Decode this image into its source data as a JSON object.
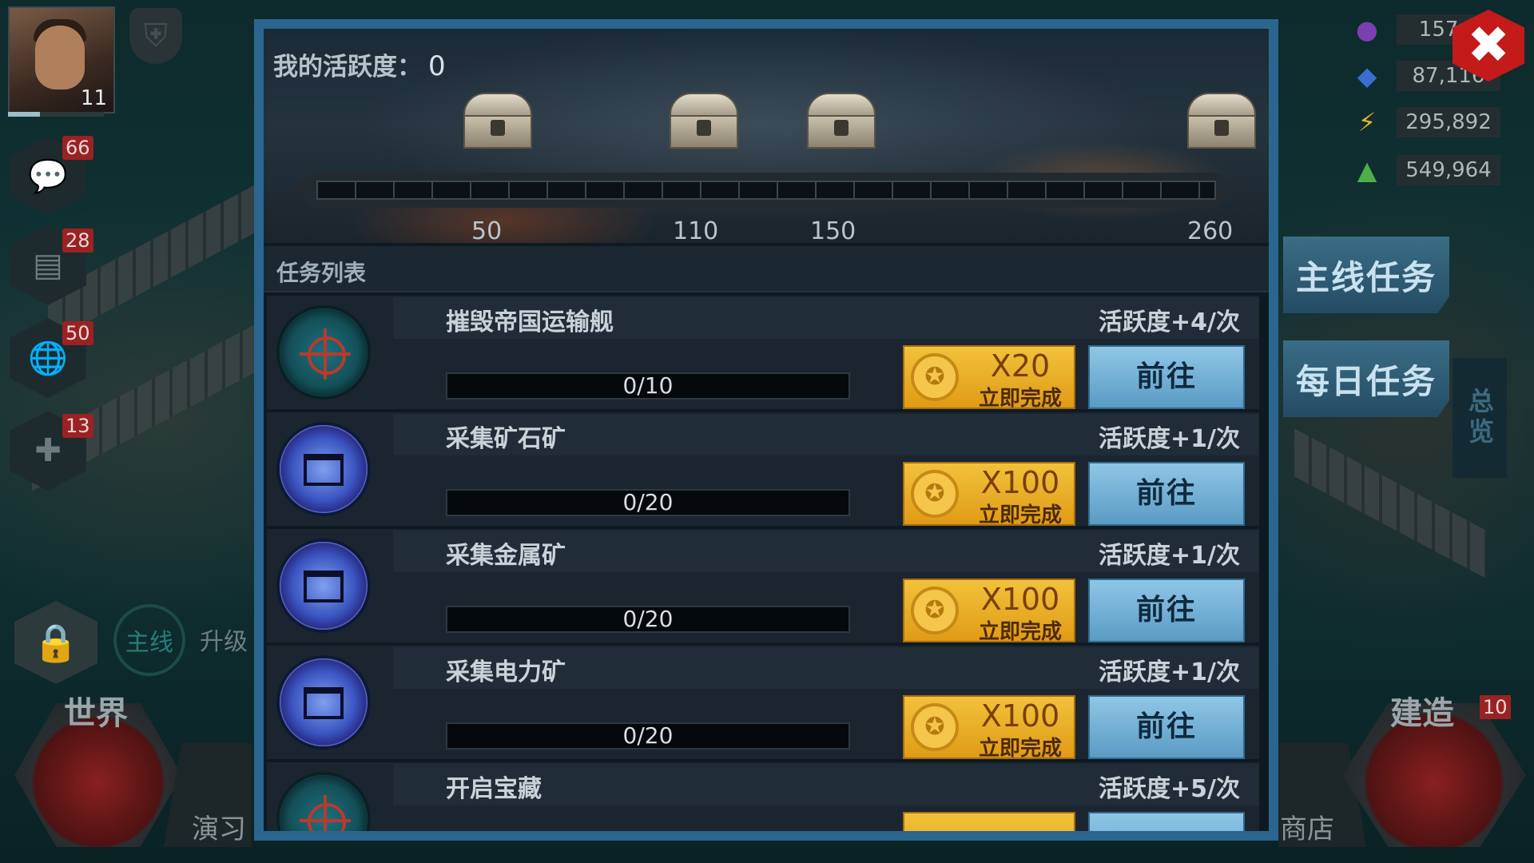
{
  "hud": {
    "player_level": "11",
    "badges": {
      "chat": "66",
      "mail": "28",
      "alliance": "50",
      "medical": "13",
      "build": "10"
    },
    "mainline_label": "主线",
    "upgrade_label": "升级",
    "world_label": "世界",
    "drill_label": "演习",
    "build_label": "建造",
    "shop_label": "商店",
    "resources": [
      {
        "icon": "oil-drop-icon",
        "value": "157,9",
        "color": "#7a3fb0"
      },
      {
        "icon": "metal-icon",
        "value": "87,116",
        "color": "#3a6fd0"
      },
      {
        "icon": "energy-icon",
        "value": "295,892",
        "color": "#e2b42a"
      },
      {
        "icon": "ore-icon",
        "value": "549,964",
        "color": "#4bb04a"
      }
    ],
    "side_tabs": {
      "main_quest": "主线任务",
      "daily_quest": "每日任务",
      "overview": "总览"
    }
  },
  "activity": {
    "label": "我的活跃度：",
    "value": "0",
    "milestones": [
      "50",
      "110",
      "150",
      "260"
    ]
  },
  "task_list": {
    "header": "任务列表",
    "tasks": [
      {
        "name": "摧毁帝国运输舰",
        "reward": "活跃度+4/次",
        "progress": "0/10",
        "cost": "X20",
        "instant": "立即完成",
        "go": "前往",
        "icon": "target-icon"
      },
      {
        "name": "采集矿石矿",
        "reward": "活跃度+1/次",
        "progress": "0/20",
        "cost": "X100",
        "instant": "立即完成",
        "go": "前往",
        "icon": "oil-pump-icon"
      },
      {
        "name": "采集金属矿",
        "reward": "活跃度+1/次",
        "progress": "0/20",
        "cost": "X100",
        "instant": "立即完成",
        "go": "前往",
        "icon": "oil-pump-icon"
      },
      {
        "name": "采集电力矿",
        "reward": "活跃度+1/次",
        "progress": "0/20",
        "cost": "X100",
        "instant": "立即完成",
        "go": "前往",
        "icon": "oil-pump-icon"
      },
      {
        "name": "开启宝藏",
        "reward": "活跃度+5/次",
        "icon": "target-icon"
      }
    ]
  },
  "colors": {
    "dialog_border": "#2a6690",
    "gold_button": "#f2c23a",
    "go_button": "#8fc6e6",
    "close": "#c41a1a"
  }
}
